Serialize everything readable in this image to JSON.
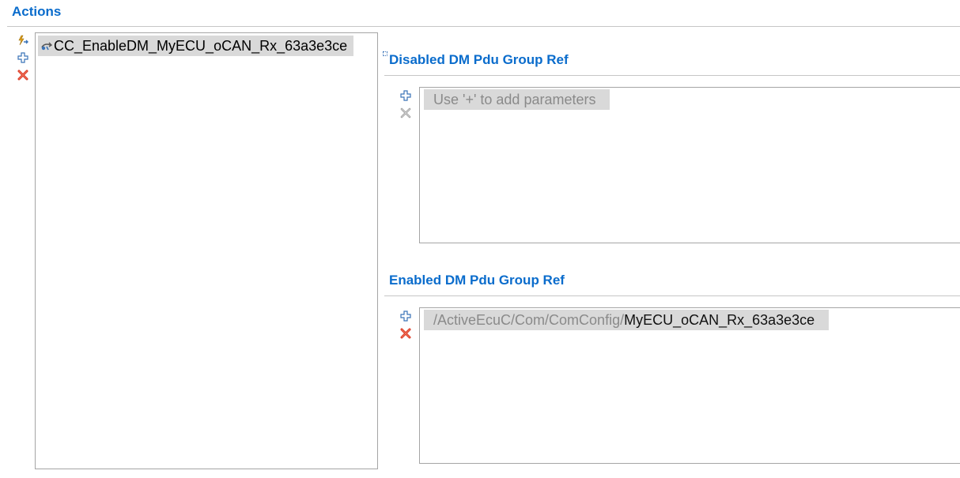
{
  "actions": {
    "title": "Actions",
    "items": [
      {
        "label": "CC_EnableDM_MyECU_oCAN_Rx_63a3e3ce",
        "icon": "action-icon"
      }
    ],
    "toolbar": {
      "run_icon": "lightning-arrow-icon",
      "add_icon": "plus-icon",
      "remove_icon": "close-icon",
      "remove_color": "#d9341f"
    }
  },
  "disabled_ref": {
    "title": "Disabled DM Pdu Group Ref",
    "placeholder": "Use '+' to add parameters",
    "toolbar": {
      "add_icon": "plus-icon",
      "remove_icon": "close-icon",
      "remove_enabled": false
    }
  },
  "enabled_ref": {
    "title": "Enabled DM Pdu Group Ref",
    "items": [
      {
        "prefix": "/ActiveEcuC/Com/ComConfig/",
        "name": "MyECU_oCAN_Rx_63a3e3ce"
      }
    ],
    "toolbar": {
      "add_icon": "plus-icon",
      "remove_icon": "close-icon",
      "remove_color": "#d9341f"
    }
  },
  "colors": {
    "accent": "#0a6ccc",
    "selection": "#d9d9d9",
    "border": "#a5a5a5"
  }
}
